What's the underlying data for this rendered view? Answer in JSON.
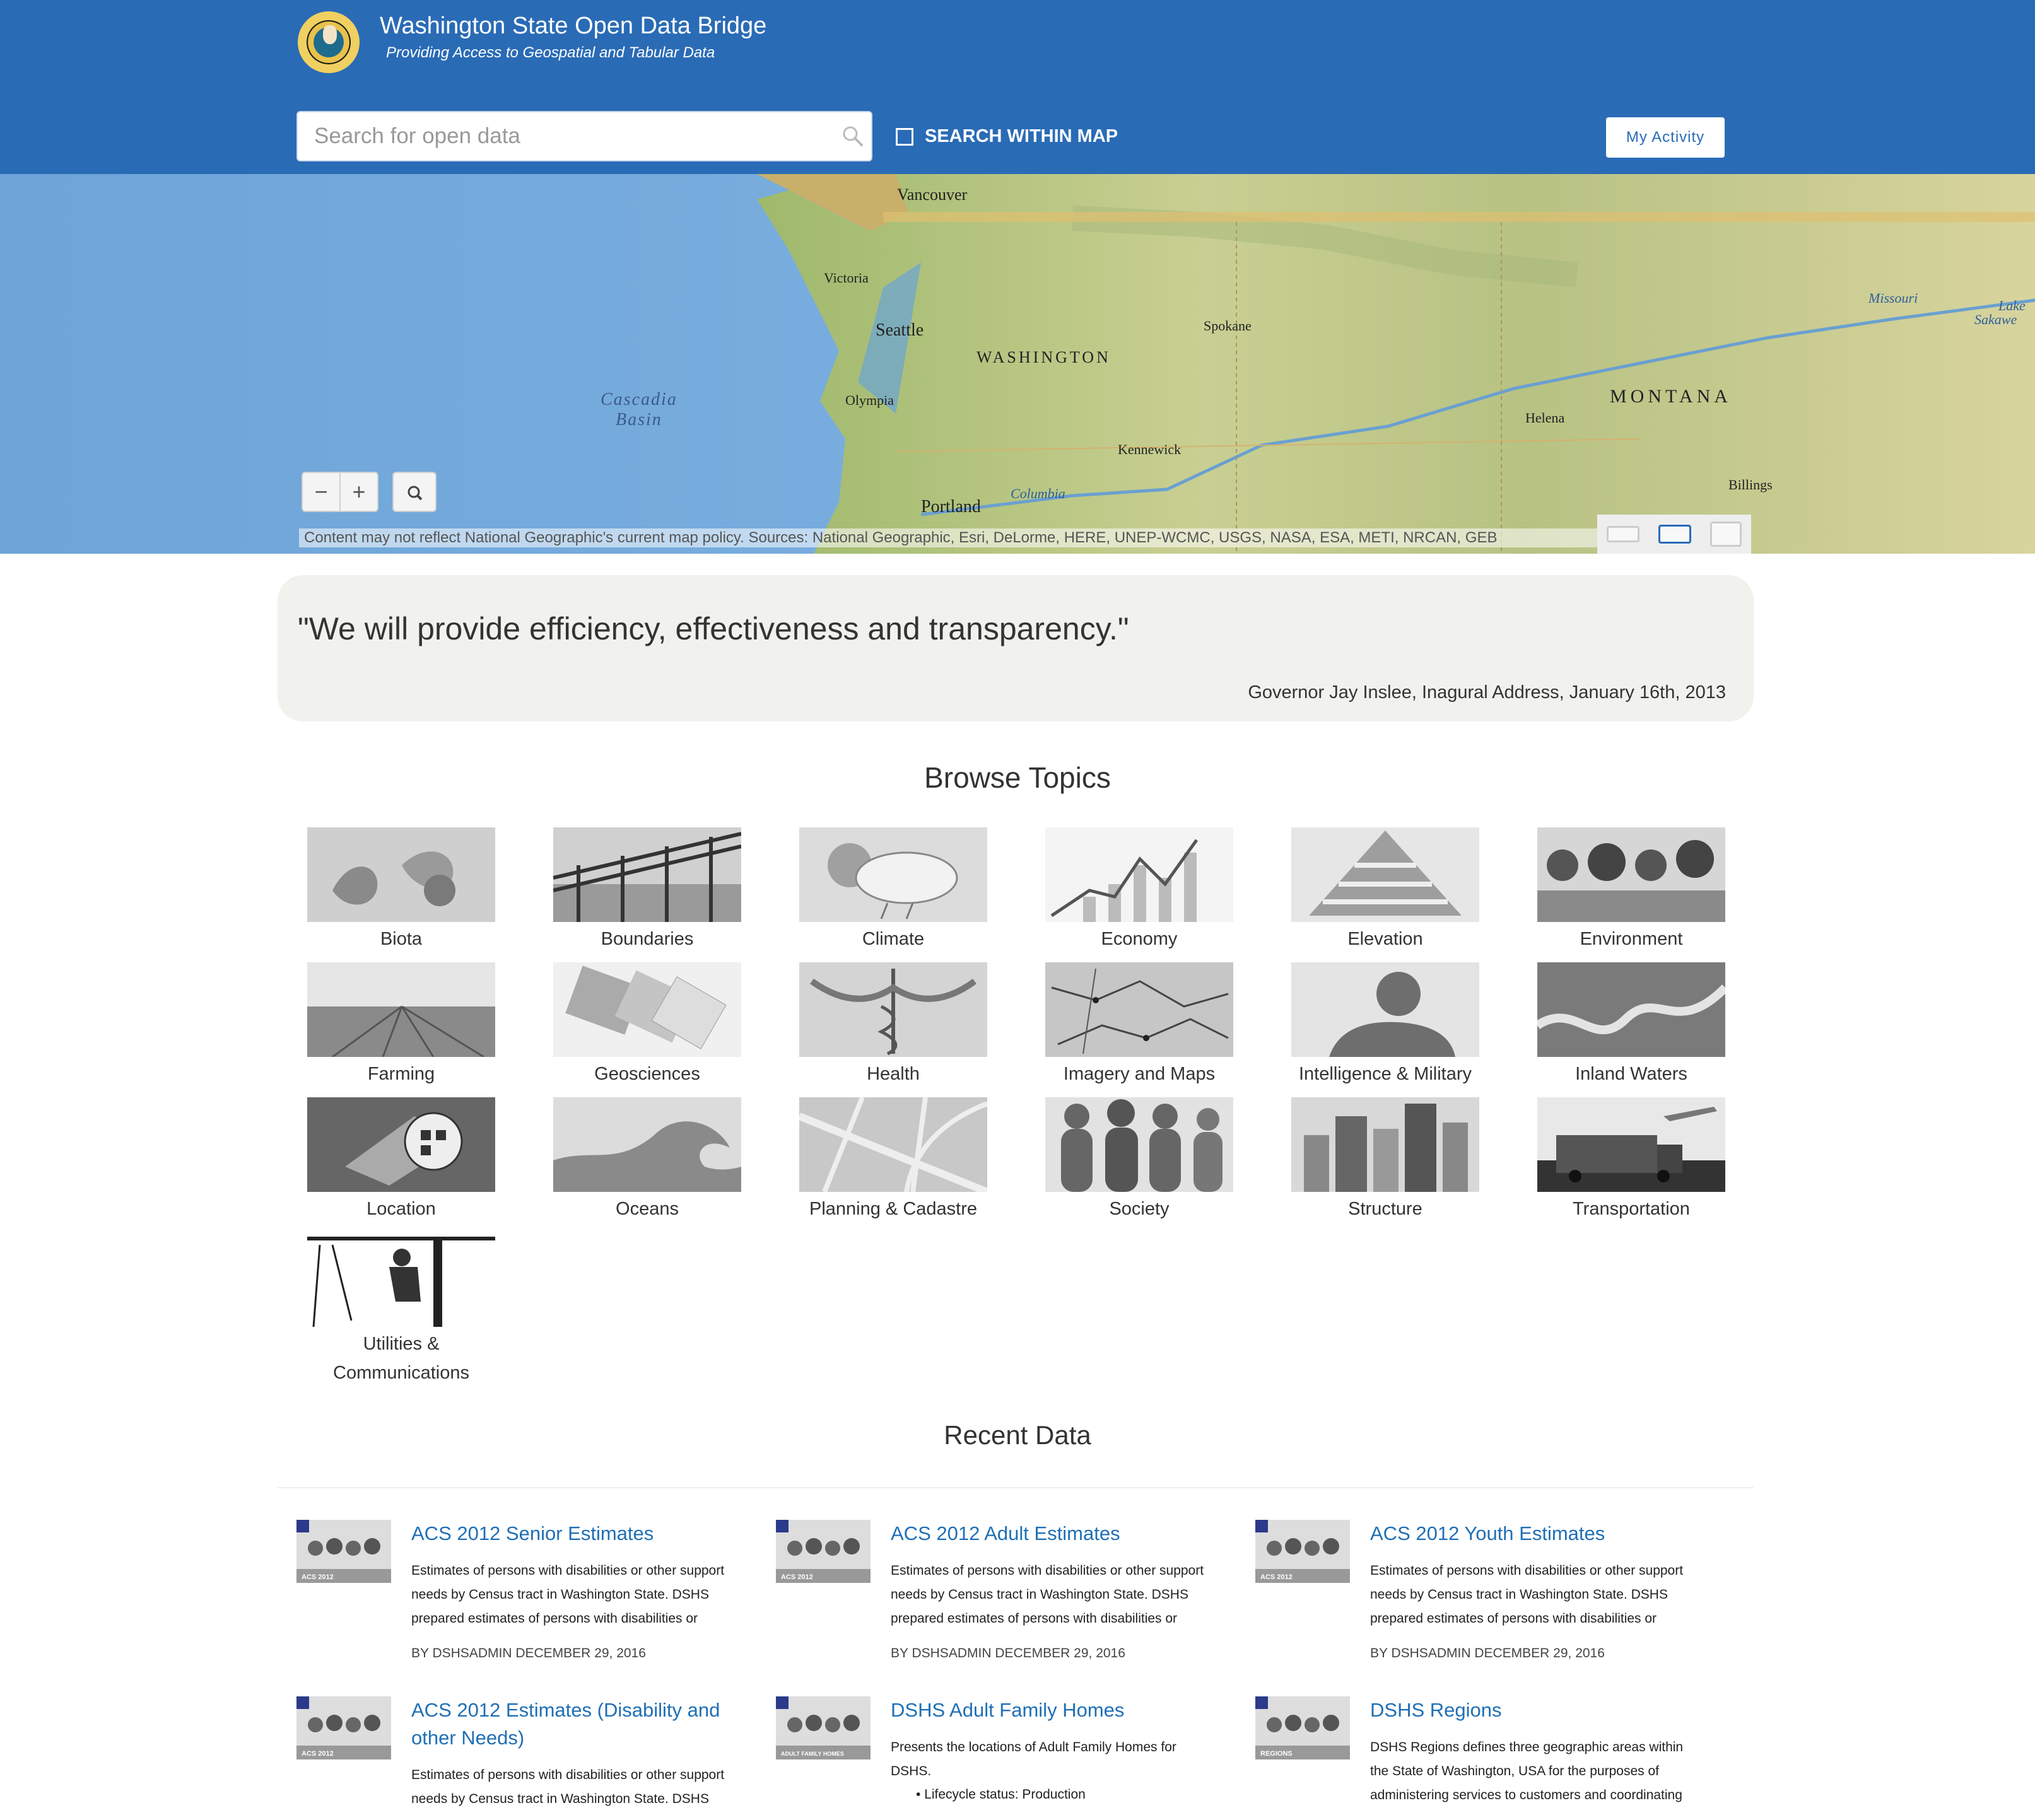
{
  "header": {
    "title": "Washington State Open Data Bridge",
    "subtitle": "Providing Access to Geospatial and Tabular Data",
    "search_placeholder": "Search for open data",
    "search_within_map": "SEARCH WITHIN MAP",
    "my_activity": "My Activity",
    "brand_color": "#2a6bb6"
  },
  "map": {
    "labels": {
      "vancouver": "Vancouver",
      "victoria": "Victoria",
      "seattle": "Seattle",
      "washington": "WASHINGTON",
      "spokane": "Spokane",
      "olympia": "Olympia",
      "cascadia": "Cascadia",
      "basin": "Basin",
      "kennewick": "Kennewick",
      "portland": "Portland",
      "columbia": "Columbia",
      "helena": "Helena",
      "montana": "MONTANA",
      "billings": "Billings",
      "missouri": "Missouri",
      "lake": "Lake",
      "sakawe": "Sakawe"
    },
    "zoom_out": "−",
    "zoom_in": "+",
    "attribution": "Content may not reflect National Geographic's current map policy. Sources: National Geographic, Esri, DeLorme, HERE, UNEP-WCMC, USGS, NASA, ESA, METI, NRCAN, GEB"
  },
  "quote": {
    "text": "\"We will provide efficiency, effectiveness and transparency.\"",
    "attribution": "Governor Jay Inslee, Inagural Address, January 16th, 2013"
  },
  "browse": {
    "title": "Browse Topics",
    "topics": [
      {
        "label": "Biota"
      },
      {
        "label": "Boundaries"
      },
      {
        "label": "Climate"
      },
      {
        "label": "Economy"
      },
      {
        "label": "Elevation"
      },
      {
        "label": "Environment"
      },
      {
        "label": "Farming"
      },
      {
        "label": "Geosciences"
      },
      {
        "label": "Health"
      },
      {
        "label": "Imagery and Maps"
      },
      {
        "label": "Intelligence & Military"
      },
      {
        "label": "Inland Waters"
      },
      {
        "label": "Location"
      },
      {
        "label": "Oceans"
      },
      {
        "label": "Planning & Cadastre"
      },
      {
        "label": "Society"
      },
      {
        "label": "Structure"
      },
      {
        "label": "Transportation"
      },
      {
        "label": "Utilities &",
        "label2": "Communications"
      }
    ]
  },
  "recent": {
    "title": "Recent Data",
    "items": [
      {
        "title": "ACS 2012 Senior Estimates",
        "thumb_label": "ACS 2012",
        "desc": [
          "Estimates of persons with disabilities or other support",
          "needs by Census tract in Washington State. DSHS",
          "prepared estimates of persons with disabilities or"
        ],
        "meta": "BY DSHSADMIN DECEMBER 29, 2016"
      },
      {
        "title": "ACS 2012 Adult Estimates",
        "thumb_label": "ACS 2012",
        "desc": [
          "Estimates of persons with disabilities or other support",
          "needs by Census tract in Washington State. DSHS",
          "prepared estimates of persons with disabilities or"
        ],
        "meta": "BY DSHSADMIN DECEMBER 29, 2016"
      },
      {
        "title": "ACS 2012 Youth Estimates",
        "thumb_label": "ACS 2012",
        "desc": [
          "Estimates of persons with disabilities or other support",
          "needs by Census tract in Washington State. DSHS",
          "prepared estimates of persons with disabilities or"
        ],
        "meta": "BY DSHSADMIN DECEMBER 29, 2016"
      },
      {
        "title": "ACS 2012 Estimates (Disability and",
        "title2": "other Needs)",
        "thumb_label": "ACS 2012",
        "desc": [
          "Estimates of persons with disabilities or other support",
          "needs by Census tract in Washington State. DSHS"
        ]
      },
      {
        "title": "DSHS Adult Family Homes",
        "thumb_label": "ADULT FAMILY HOMES",
        "desc": [
          "Presents the locations of Adult Family Homes for",
          "DSHS."
        ],
        "bullet": "Lifecycle status: Production"
      },
      {
        "title": "DSHS Regions",
        "thumb_label": "REGIONS",
        "desc": [
          "DSHS Regions defines three geographic areas within",
          "the State of Washington, USA for the purposes of",
          "administering services to customers and coordinating"
        ]
      }
    ]
  }
}
